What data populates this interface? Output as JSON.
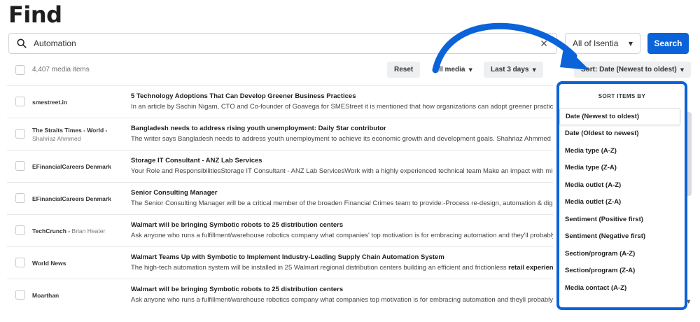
{
  "page": {
    "title": "Find"
  },
  "search": {
    "value": "Automation",
    "clear_icon": "close-icon",
    "scope": "All of Isentia",
    "button_label": "Search"
  },
  "toolbar": {
    "count_label": "4,407 media items",
    "reset_label": "Reset",
    "media_filter_label": "All media",
    "date_filter_label": "Last 3 days",
    "sort_label": "Sort: Date (Newest to oldest)"
  },
  "results": [
    {
      "source": "smestreet.in",
      "author": "",
      "headline": "5 Technology Adoptions That Can Develop Greener Business Practices",
      "snippet": "In an article by Sachin Nigam, CTO and Co-founder of Goavega for SMEStreet it is mentioned that how organizations can adopt greener practices"
    },
    {
      "source": "The Straits Times - World",
      "author": "Shahriaz Ahmmed",
      "headline": "Bangladesh needs to address rising youth unemployment: Daily Star contributor",
      "snippet": "The writer says Bangladesh needs to address youth unemployment to achieve its economic growth and development goals. Shahriaz Ahmmed Daily"
    },
    {
      "source": "EFinancialCareers Denmark",
      "author": "",
      "headline": "Storage IT Consultant - ANZ Lab Services",
      "snippet": "Your Role and ResponsibilitiesStorage IT Consultant - ANZ Lab ServicesWork with a highly experienced technical team Make an impact with mission"
    },
    {
      "source": "EFinancialCareers Denmark",
      "author": "",
      "headline": "Senior Consulting Manager",
      "snippet": "The Senior Consulting Manager will be a critical member of the broaden Financial Crimes team to provide:-Process re-design, automation & digital"
    },
    {
      "source": "TechCrunch",
      "author": "Brian Heater",
      "headline": "Walmart will be bringing Symbotic robots to 25 distribution centers",
      "snippet": "Ask anyone who runs a fulfillment/warehouse robotics company what companies' top motivation is for embracing automation and they'll probably"
    },
    {
      "source": "World News",
      "author": "",
      "headline": "Walmart Teams Up with Symbotic to Implement Industry-Leading Supply Chain Automation System",
      "snippet": "The high-tech automation system will be installed in 25 Walmart regional distribution centers building an efficient and frictionless",
      "snippet_bold": "retail experience"
    },
    {
      "source": "Moarthan",
      "author": "",
      "headline": "Walmart will be bringing Symbotic robots to 25 distribution centers",
      "snippet": "Ask anyone who runs a fulfillment/warehouse robotics company what companies top motivation is for embracing automation and theyll probably"
    }
  ],
  "sort_menu": {
    "title": "SORT ITEMS BY",
    "options": [
      "Date (Newest to oldest)",
      "Date (Oldest to newest)",
      "Media type (A-Z)",
      "Media type (Z-A)",
      "Media outlet (A-Z)",
      "Media outlet (Z-A)",
      "Sentiment (Positive first)",
      "Sentiment (Negative first)",
      "Section/program (A-Z)",
      "Section/program (Z-A)",
      "Media contact (A-Z)"
    ]
  },
  "colors": {
    "accent": "#0a63d8",
    "annotation": "#0a63d8"
  }
}
